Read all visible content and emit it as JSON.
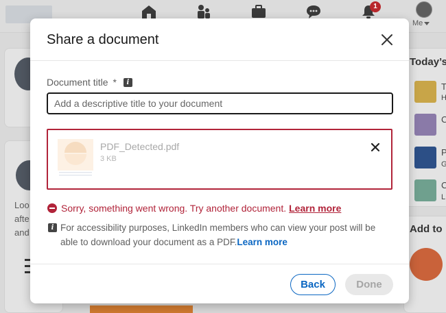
{
  "background": {
    "nav": {
      "notification_count": "1",
      "me_label": "Me"
    },
    "right_rail": {
      "today_title": "Today’s",
      "add_title": "Add to",
      "tile_letters": [
        "T",
        "C",
        "P",
        "C"
      ],
      "tile_subletters": [
        "H",
        "",
        "G",
        "L"
      ]
    },
    "feed_text": [
      "Loo",
      "afte",
      "and"
    ]
  },
  "modal": {
    "title": "Share a document",
    "document_title_label": "Document title",
    "required_marker": "*",
    "title_input": {
      "value": "",
      "placeholder": "Add a descriptive title to your document"
    },
    "file": {
      "name": "PDF_Detected.pdf",
      "size": "3 KB"
    },
    "error": {
      "message": "Sorry, something went wrong. Try another document.",
      "link": "Learn more"
    },
    "accessibility": {
      "message": "For accessibility purposes, LinkedIn members who can view your post will be able to download your document as a PDF.",
      "link": "Learn more"
    },
    "buttons": {
      "back": "Back",
      "done": "Done"
    }
  },
  "colors": {
    "accent": "#0a66c2",
    "error": "#b12339",
    "disabled_bg": "#e8e8e8"
  }
}
